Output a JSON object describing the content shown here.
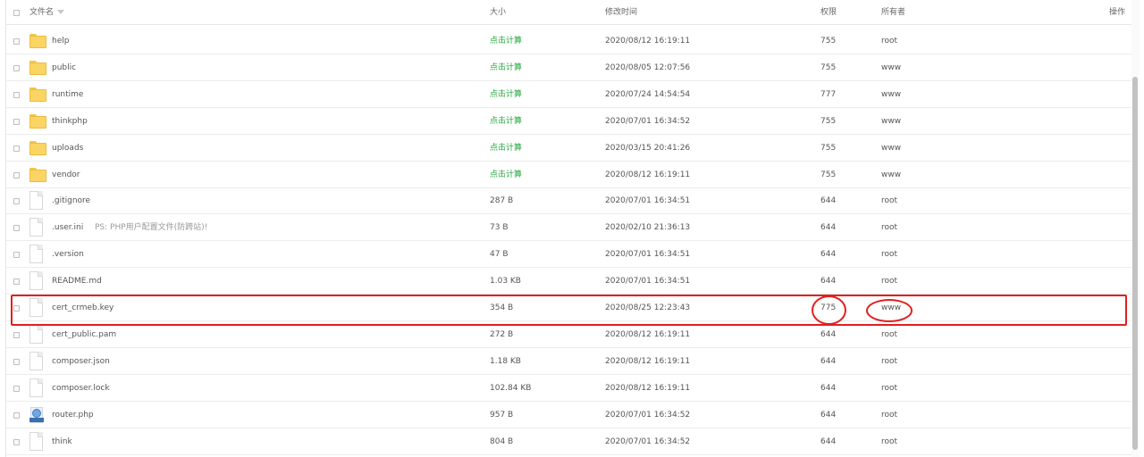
{
  "header": {
    "name": "文件名",
    "size": "大小",
    "modified": "修改时间",
    "permission": "权限",
    "owner": "所有者",
    "actions": "操作"
  },
  "calc_label": "点击计算",
  "accent_color": "#20a53a",
  "highlight_color": "#e02020",
  "files": [
    {
      "name": "help",
      "type": "folder",
      "size": "点击计算",
      "time": "2020/08/12 16:19:11",
      "perm": "755",
      "owner": "root"
    },
    {
      "name": "public",
      "type": "folder",
      "size": "点击计算",
      "time": "2020/08/05 12:07:56",
      "perm": "755",
      "owner": "www"
    },
    {
      "name": "runtime",
      "type": "folder",
      "size": "点击计算",
      "time": "2020/07/24 14:54:54",
      "perm": "777",
      "owner": "www"
    },
    {
      "name": "thinkphp",
      "type": "folder",
      "size": "点击计算",
      "time": "2020/07/01 16:34:52",
      "perm": "755",
      "owner": "www"
    },
    {
      "name": "uploads",
      "type": "folder",
      "size": "点击计算",
      "time": "2020/03/15 20:41:26",
      "perm": "755",
      "owner": "www"
    },
    {
      "name": "vendor",
      "type": "folder",
      "size": "点击计算",
      "time": "2020/08/12 16:19:11",
      "perm": "755",
      "owner": "www"
    },
    {
      "name": ".gitignore",
      "type": "file",
      "size": "287 B",
      "time": "2020/07/01 16:34:51",
      "perm": "644",
      "owner": "root"
    },
    {
      "name": ".user.ini",
      "type": "file",
      "note": "PS: PHP用户配置文件(防跨站)!",
      "size": "73 B",
      "time": "2020/02/10 21:36:13",
      "perm": "644",
      "owner": "root"
    },
    {
      "name": ".version",
      "type": "file",
      "size": "47 B",
      "time": "2020/07/01 16:34:51",
      "perm": "644",
      "owner": "root"
    },
    {
      "name": "README.md",
      "type": "file",
      "size": "1.03 KB",
      "time": "2020/07/01 16:34:51",
      "perm": "644",
      "owner": "root"
    },
    {
      "name": "cert_crmeb.key",
      "type": "file",
      "size": "354 B",
      "time": "2020/08/25 12:23:43",
      "perm": "775",
      "owner": "www",
      "highlighted": true
    },
    {
      "name": "cert_public.pam",
      "type": "file",
      "size": "272 B",
      "time": "2020/08/12 16:19:11",
      "perm": "644",
      "owner": "root"
    },
    {
      "name": "composer.json",
      "type": "file",
      "size": "1.18 KB",
      "time": "2020/08/12 16:19:11",
      "perm": "644",
      "owner": "root"
    },
    {
      "name": "composer.lock",
      "type": "file",
      "size": "102.84 KB",
      "time": "2020/08/12 16:19:11",
      "perm": "644",
      "owner": "root"
    },
    {
      "name": "router.php",
      "type": "php",
      "size": "957 B",
      "time": "2020/07/01 16:34:52",
      "perm": "644",
      "owner": "root"
    },
    {
      "name": "think",
      "type": "file",
      "size": "804 B",
      "time": "2020/07/01 16:34:52",
      "perm": "644",
      "owner": "root"
    }
  ]
}
